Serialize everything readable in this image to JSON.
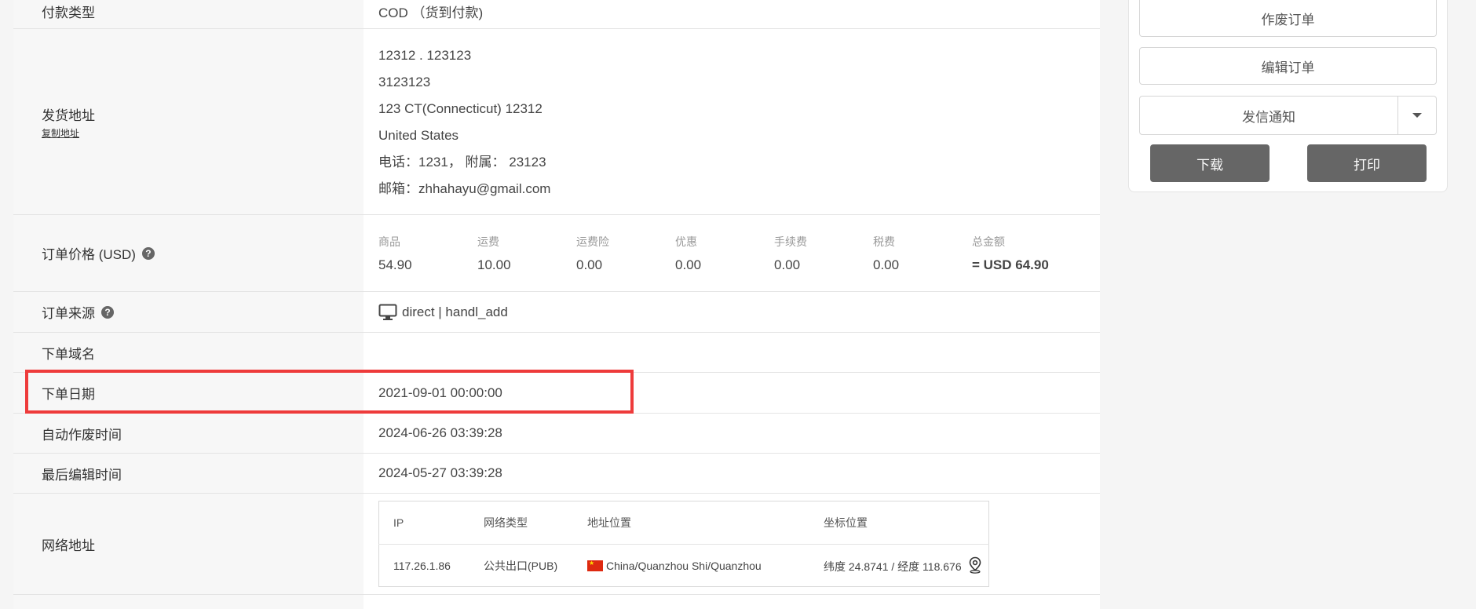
{
  "rows": {
    "payment_type": {
      "label": "付款类型",
      "value": "COD （货到付款)"
    },
    "ship_address": {
      "label": "发货地址",
      "copy_link": "复制地址",
      "lines": [
        "12312 . 123123",
        "3123123",
        "123 CT(Connecticut) 12312",
        "United States",
        "电话：1231， 附属： 23123",
        "邮箱：zhhahayu@gmail.com"
      ]
    },
    "order_price": {
      "label": "订单价格 (USD)",
      "columns": [
        {
          "key": "商品",
          "value": "54.90"
        },
        {
          "key": "运费",
          "value": "10.00"
        },
        {
          "key": "运费险",
          "value": "0.00"
        },
        {
          "key": "优惠",
          "value": "0.00"
        },
        {
          "key": "手续费",
          "value": "0.00"
        },
        {
          "key": "税费",
          "value": "0.00"
        },
        {
          "key": "总金额",
          "value": "= USD 64.90"
        }
      ]
    },
    "order_source": {
      "label": "订单来源",
      "value": "direct | handl_add"
    },
    "order_domain": {
      "label": "下单域名",
      "value": ""
    },
    "order_date": {
      "label": "下单日期",
      "value": "2021-09-01 00:00:00"
    },
    "auto_void_time": {
      "label": "自动作废时间",
      "value": "2024-06-26 03:39:28"
    },
    "last_edit_time": {
      "label": "最后编辑时间",
      "value": "2024-05-27 03:39:28"
    },
    "network": {
      "label": "网络地址",
      "headers": [
        "IP",
        "网络类型",
        "地址位置",
        "坐标位置"
      ],
      "row": {
        "ip": "117.26.1.86",
        "net_type": "公共出口(PUB)",
        "location": "China/Quanzhou Shi/Quanzhou",
        "coords": "纬度 24.8741 / 经度 118.676"
      }
    }
  },
  "actions": {
    "void_order": "作废订单",
    "edit_order": "编辑订单",
    "send_notice": "发信通知",
    "download": "下载",
    "print": "打印"
  },
  "icons": {
    "help": "question-circle-icon",
    "source": "monitor-icon",
    "flag": "china-flag-icon",
    "location": "map-pin-icon",
    "dropdown": "caret-down-icon"
  },
  "colors": {
    "highlight": "#ee3b3b",
    "dark_button": "#666666"
  }
}
